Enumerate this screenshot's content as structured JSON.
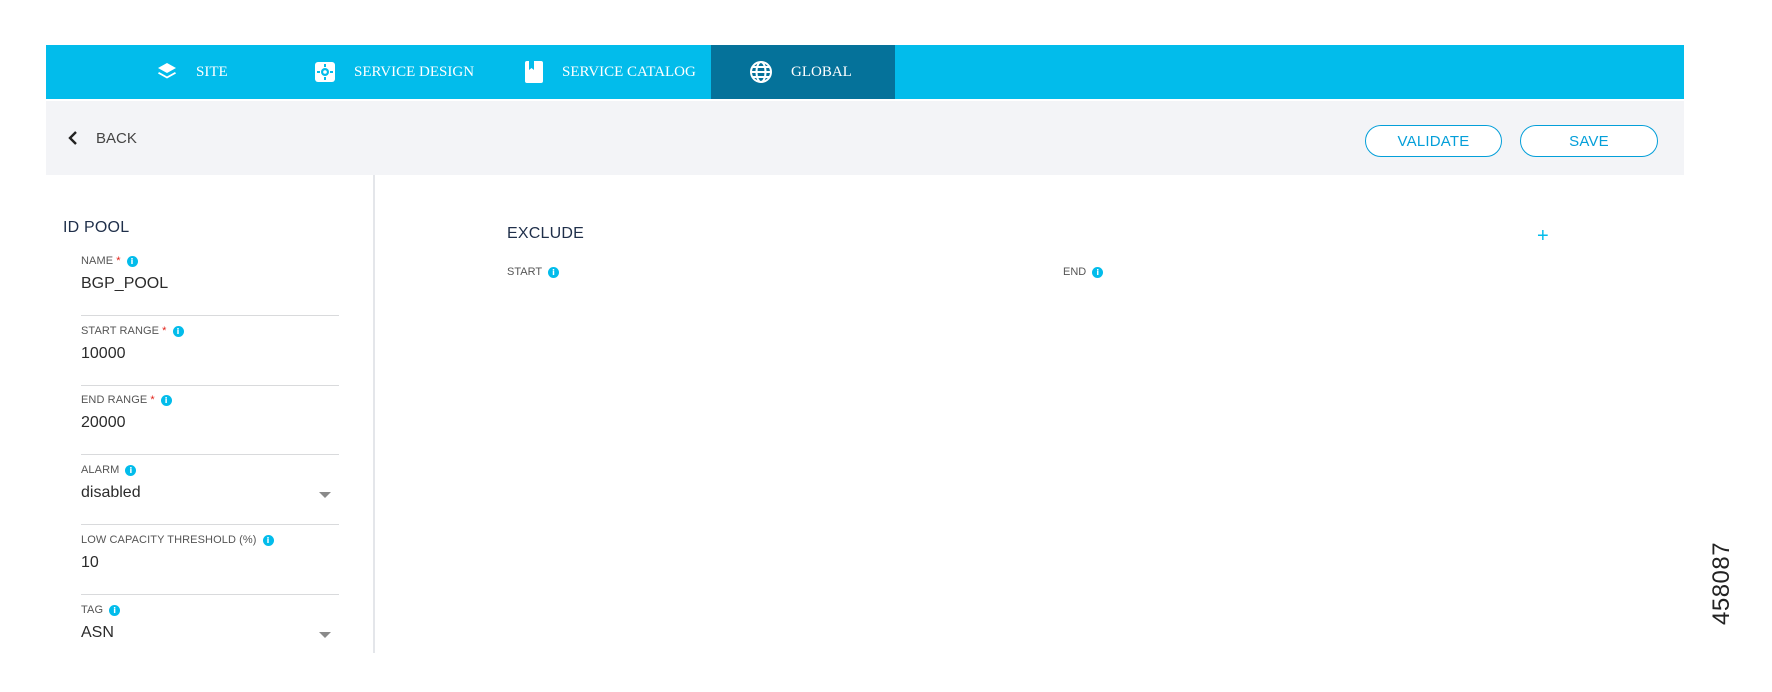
{
  "nav": {
    "tabs": [
      {
        "label": "SITE",
        "icon": "layers-icon"
      },
      {
        "label": "SERVICE DESIGN",
        "icon": "service-design-icon"
      },
      {
        "label": "SERVICE CATALOG",
        "icon": "book-icon"
      },
      {
        "label": "GLOBAL",
        "icon": "globe-icon",
        "active": true
      }
    ]
  },
  "toolbar": {
    "back_label": "BACK",
    "validate_label": "VALIDATE",
    "save_label": "SAVE"
  },
  "form": {
    "title": "ID POOL",
    "fields": [
      {
        "label": "NAME",
        "required": "*",
        "value": "BGP_POOL"
      },
      {
        "label": "START RANGE",
        "required": "*",
        "value": "10000"
      },
      {
        "label": "END RANGE",
        "required": "*",
        "value": "20000"
      },
      {
        "label": "ALARM",
        "value": "disabled",
        "type": "select"
      },
      {
        "label": "LOW CAPACITY THRESHOLD (%)",
        "value": "10"
      },
      {
        "label": "TAG",
        "value": "ASN",
        "type": "select"
      }
    ]
  },
  "exclude": {
    "title": "EXCLUDE",
    "start_label": "START",
    "end_label": "END",
    "add_symbol": "+"
  },
  "figure_id": "458087",
  "colors": {
    "nav_bg": "#02bceb",
    "nav_active": "#05729a",
    "accent": "#049fd9",
    "subbar_bg": "#f3f4f7",
    "required": "#e2231a"
  }
}
